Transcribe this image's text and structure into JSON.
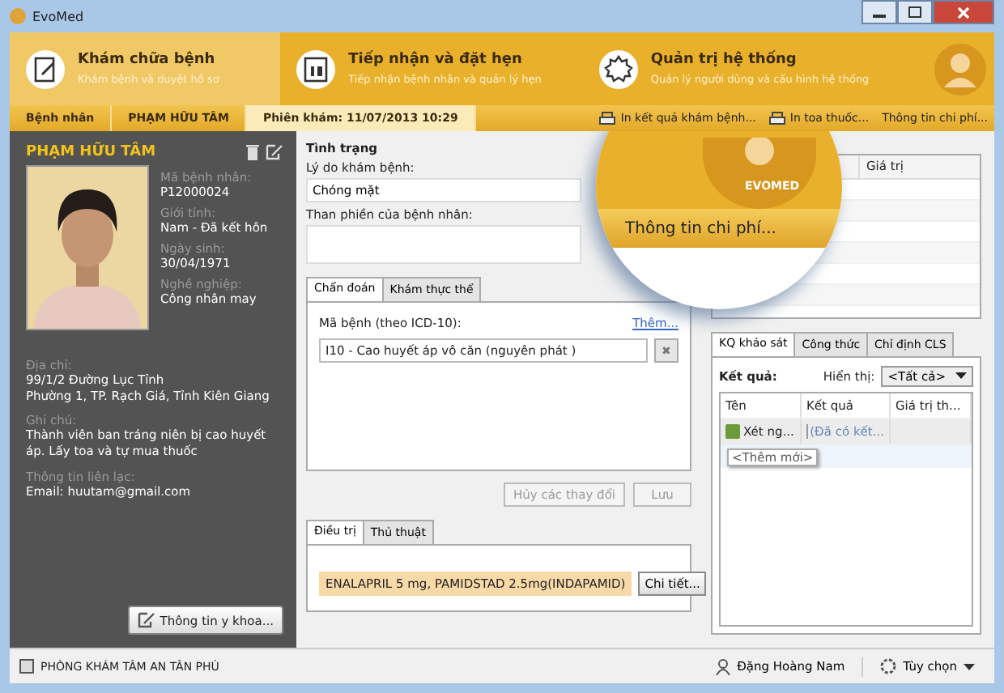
{
  "window": {
    "title": "EvoMed"
  },
  "nav": [
    {
      "title": "Khám chữa bệnh",
      "subtitle": "Khám bệnh và duyệt hồ sơ",
      "selected": true
    },
    {
      "title": "Tiếp nhận và đặt hẹn",
      "subtitle": "Tiếp nhận bệnh nhân và quản lý hẹn",
      "selected": false
    },
    {
      "title": "Quản trị hệ thống",
      "subtitle": "Quản lý người dùng và cấu hình hệ thống",
      "selected": false
    }
  ],
  "breadcrumb": [
    {
      "label": "Bệnh nhân",
      "selected": false
    },
    {
      "label": "PHẠM HỮU TÂM",
      "selected": false
    },
    {
      "label": "Phiên khám: 11/07/2013 10:29",
      "selected": true
    }
  ],
  "actions": [
    {
      "label": "In kết quả khám bệnh...",
      "printer": true
    },
    {
      "label": "In toa thuốc...",
      "printer": true
    },
    {
      "label": "Thông tin chi phí...",
      "printer": false
    }
  ],
  "patient": {
    "name": "PHẠM HỮU TÂM",
    "fields": [
      {
        "label": "Mã bệnh nhân:",
        "value": "P12000024"
      },
      {
        "label": "Giới tính:",
        "value": "Nam - Đã kết hôn"
      },
      {
        "label": "Ngày sinh:",
        "value": "30/04/1971"
      },
      {
        "label": "Nghề nghiệp:",
        "value": "Công nhân may"
      }
    ],
    "details": [
      {
        "label": "Địa chỉ:",
        "lines": [
          "99/1/2 Đường Lục Tỉnh",
          "Phường 1, TP. Rạch Giá, Tỉnh Kiên Giang"
        ]
      },
      {
        "label": "Ghi chú:",
        "lines": [
          "Thành viên ban tráng niên bị cao huyết áp. Lấy toa và tự mua thuốc"
        ]
      },
      {
        "label": "Thông tin liên lạc:",
        "lines": [
          "Email: huutam@gmail.com"
        ]
      }
    ],
    "button": "Thông tin y khoa..."
  },
  "condition": {
    "heading": "Tình trạng",
    "reason_label": "Lý do khám bệnh:",
    "reason": "Chóng mặt",
    "complaint_label": "Than phiền của bệnh nhân:"
  },
  "diag_tabs": [
    {
      "label": "Chẩn đoán",
      "selected": true
    },
    {
      "label": "Khám thực thể",
      "selected": false
    }
  ],
  "diagnosis": {
    "label": "Mã bệnh (theo ICD-10):",
    "link": "Thêm...",
    "code": "I10 - Cao huyết áp vô căn (nguyên phát )",
    "remove": "✖"
  },
  "form_buttons": [
    {
      "label": "Hủy các thay đổi",
      "disabled": true
    },
    {
      "label": "Lưu",
      "disabled": true
    }
  ],
  "treat_tabs": [
    {
      "label": "Điều trị",
      "selected": true
    },
    {
      "label": "Thủ thuật",
      "selected": false
    }
  ],
  "treatment": {
    "drugs": "ENALAPRIL 5 mg, PAMIDSTAD 2.5mg(INDAPAMID)",
    "button": "Chi tiết..."
  },
  "vitals": {
    "columns": [
      "Giá trị"
    ]
  },
  "lens": {
    "label": "Thông tin chi phí...",
    "logo": "EVOMED"
  },
  "result_tabs": [
    {
      "label": "KQ khảo sát",
      "selected": true
    },
    {
      "label": "Công thức",
      "selected": false
    },
    {
      "label": "Chỉ định CLS",
      "selected": false
    }
  ],
  "results": {
    "label": "Kết quả:",
    "filter_label": "Hiển thị:",
    "filter": "<Tất cả>",
    "columns": [
      "Tên",
      "Kết quả",
      "Giá trị th..."
    ],
    "rows": [
      {
        "name": "Xét ng...",
        "result": "(Đã có kết..."
      }
    ],
    "add": "<Thêm mới>"
  },
  "status_bar": {
    "clinic": "PHÒNG KHÁM TÂM AN TÂN PHÚ",
    "user": "Đặng Hoàng Nam",
    "options": "Tùy chọn"
  }
}
